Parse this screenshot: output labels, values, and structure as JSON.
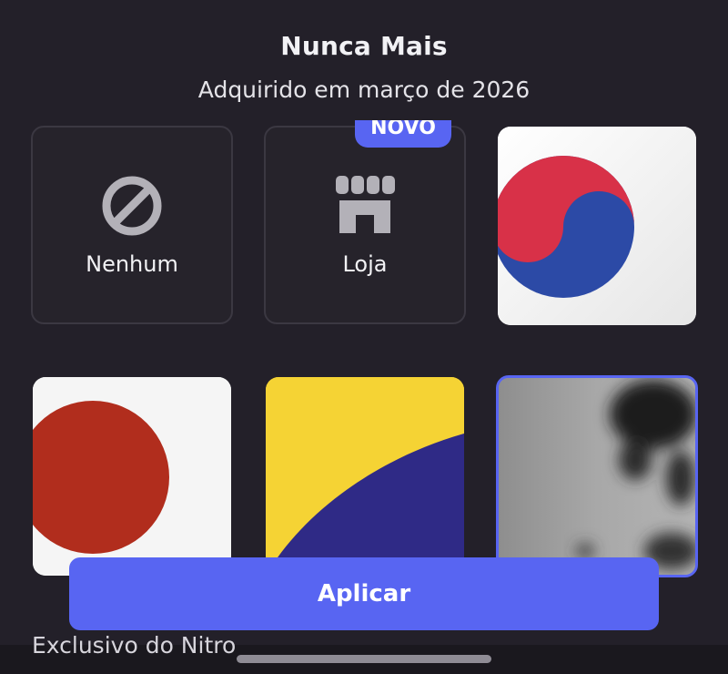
{
  "header": {
    "title": "Nunca Mais",
    "subtitle": "Adquirido em março de 2026"
  },
  "options": {
    "none_label": "Nenhum",
    "shop_label": "Loja",
    "new_badge": "NOVO"
  },
  "footer": {
    "apply_label": "Aplicar",
    "nitro_exclusive": "Exclusivo do Nitro"
  },
  "colors": {
    "background": "#232029",
    "accent": "#5865f2"
  },
  "icons": {
    "none": "ban-icon",
    "shop": "storefront-icon"
  }
}
